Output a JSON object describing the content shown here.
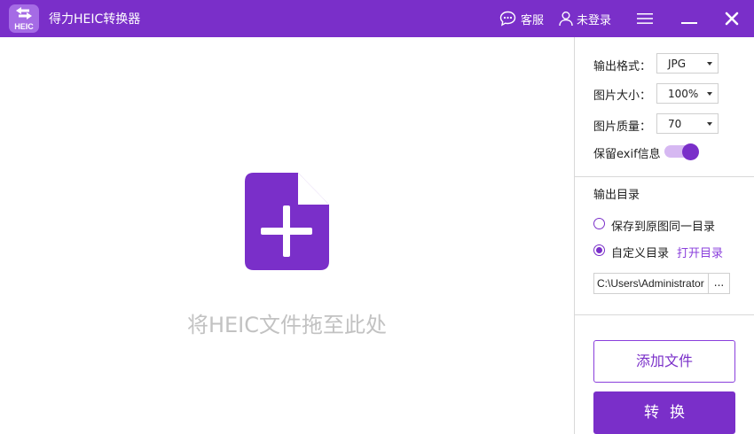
{
  "app": {
    "logo_text": "HEIC",
    "title": "得力HEIC转换器"
  },
  "titlebar": {
    "support_label": "客服",
    "login_label": "未登录"
  },
  "dropzone": {
    "hint_text": "将HEIC文件拖至此处"
  },
  "settings": {
    "format_label": "输出格式：",
    "format_value": "JPG",
    "size_label": "图片大小：",
    "size_value": "100%",
    "quality_label": "图片质量：",
    "quality_value": "70",
    "exif_label": "保留exif信息",
    "exif_enabled": true
  },
  "output": {
    "section_title": "输出目录",
    "option_same_label": "保存到原图同一目录",
    "option_custom_label": "自定义目录",
    "selected_option": "custom",
    "open_dir_label": "打开目录",
    "path_value": "C:\\Users\\Administrator",
    "browse_label": "..."
  },
  "actions": {
    "add_files_label": "添加文件",
    "convert_label": "转换"
  },
  "colors": {
    "brand": "#7a2fc9",
    "toggle_track": "#d6b8f2",
    "drop_text": "#c2c2c2"
  }
}
